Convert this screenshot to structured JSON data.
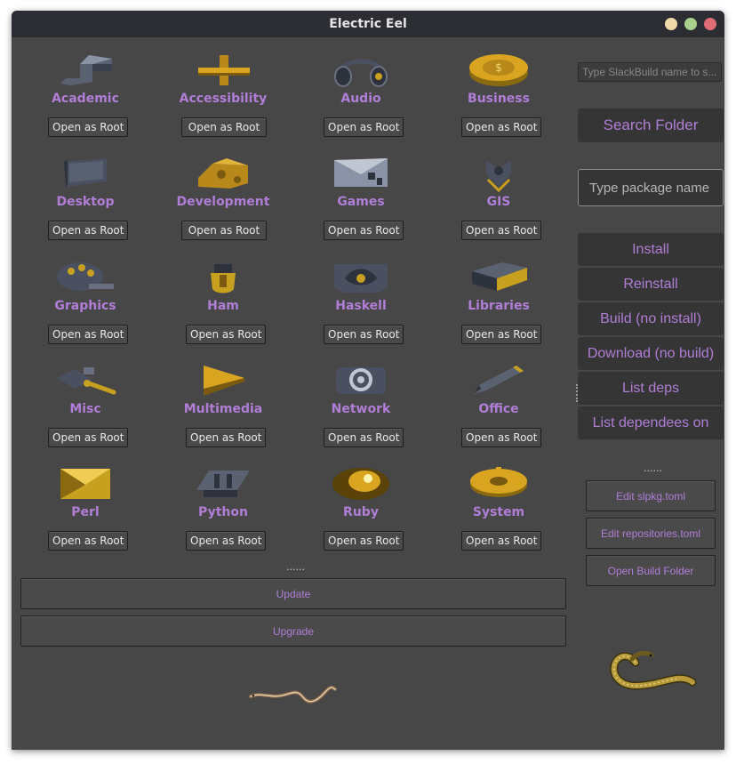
{
  "window": {
    "title": "Electric Eel"
  },
  "categories": [
    {
      "label": "Academic",
      "icon": "academic-icon"
    },
    {
      "label": "Accessibility",
      "icon": "accessibility-icon"
    },
    {
      "label": "Audio",
      "icon": "headphones-icon"
    },
    {
      "label": "Business",
      "icon": "coin-icon"
    },
    {
      "label": "Desktop",
      "icon": "monitor-icon"
    },
    {
      "label": "Development",
      "icon": "puzzle-icon"
    },
    {
      "label": "Games",
      "icon": "games-icon"
    },
    {
      "label": "GIS",
      "icon": "map-pin-icon"
    },
    {
      "label": "Graphics",
      "icon": "palette-icon"
    },
    {
      "label": "Ham",
      "icon": "ham-icon"
    },
    {
      "label": "Haskell",
      "icon": "haskell-icon"
    },
    {
      "label": "Libraries",
      "icon": "book-icon"
    },
    {
      "label": "Misc",
      "icon": "tools-icon"
    },
    {
      "label": "Multimedia",
      "icon": "play-icon"
    },
    {
      "label": "Network",
      "icon": "at-sign-icon"
    },
    {
      "label": "Office",
      "icon": "pen-icon"
    },
    {
      "label": "Perl",
      "icon": "perl-icon"
    },
    {
      "label": "Python",
      "icon": "hash-icon"
    },
    {
      "label": "Ruby",
      "icon": "gem-icon"
    },
    {
      "label": "System",
      "icon": "gear-icon"
    }
  ],
  "open_root_label": "Open as Root",
  "main": {
    "divider": "......",
    "update_label": "Update",
    "upgrade_label": "Upgrade"
  },
  "sidebar": {
    "slackbuild_placeholder": "Type SlackBuild name to s...",
    "search_folder_label": "Search Folder",
    "package_placeholder": "Type package name",
    "actions": [
      "Install",
      "Reinstall",
      "Build (no install)",
      "Download (no build)",
      "List deps",
      "List dependees on"
    ],
    "divider": "......",
    "edit_slpkg_label": "Edit slpkg.toml",
    "edit_repos_label": "Edit repositories.toml",
    "open_build_label": "Open Build Folder"
  },
  "colors": {
    "accent": "#b07ed6",
    "gold": "#c8a020",
    "steel": "#5a6170",
    "background": "#474747"
  }
}
